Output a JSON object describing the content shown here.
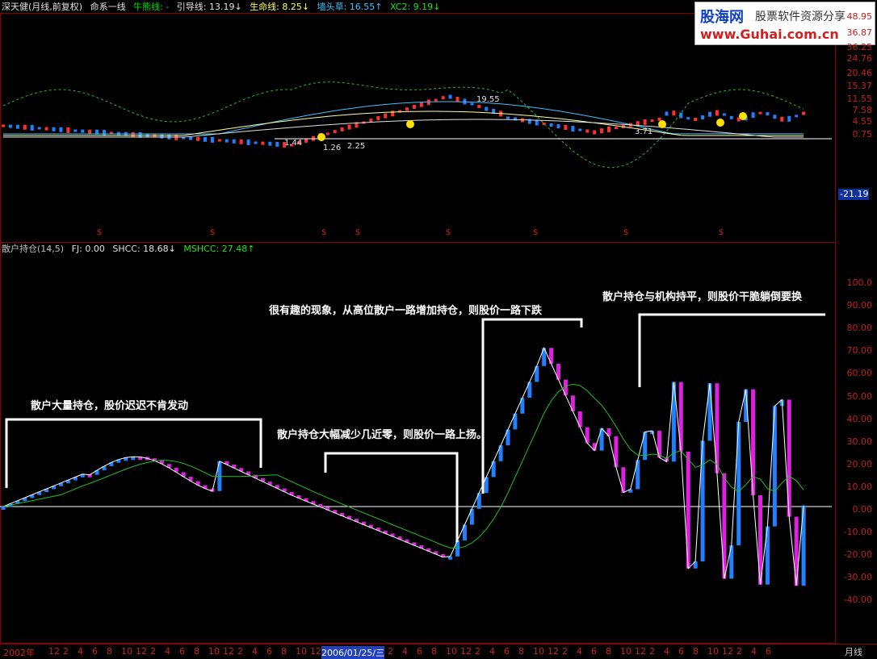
{
  "top": {
    "title": "深天健(月线,前复权)",
    "indicator_name": "命系一线",
    "items": [
      {
        "label": "牛熊线: -",
        "color": "#00e000"
      },
      {
        "label": "引导线: 13.19↓",
        "color": "#e0e0e0"
      },
      {
        "label": "生命线: 8.25↓",
        "color": "#ffff60"
      },
      {
        "label": "墙头草: 16.55↑",
        "color": "#40c0ff"
      },
      {
        "label": "XC2: 9.19↓",
        "color": "#20e020"
      }
    ],
    "axis_labels": [
      "48.95",
      "36.87",
      "36.25",
      "24.76",
      "20.46",
      "15.37",
      "11.55",
      "7.58",
      "4.55",
      "0.75"
    ],
    "price_marks": [
      "1.44",
      "1.26",
      "2.25",
      "19.55",
      "3.71"
    ],
    "side_value": "-21.19"
  },
  "bottom_panel": {
    "items": [
      {
        "label": "散户持仓(14,5)",
        "color": "#c0c0c0"
      },
      {
        "label": "FJ: 0.00",
        "color": "#e0e0e0"
      },
      {
        "label": "SHCC: 18.68↓",
        "color": "#e0e0e0"
      },
      {
        "label": "MSHCC: 27.48↑",
        "color": "#20e020"
      }
    ],
    "axis_labels": [
      "100.0",
      "90.00",
      "80.00",
      "70.00",
      "60.00",
      "50.00",
      "40.00",
      "30.00",
      "20.00",
      "10.00",
      "0.00",
      "-10.00",
      "-20.00",
      "-30.00",
      "-40.00"
    ]
  },
  "annotations": [
    "散户大量持仓，股价迟迟不肯发动",
    "散户持仓大幅减少几近零，则股价一路上扬。",
    "很有趣的现象，从高位散户一路增加持仓，则股价一路下跌",
    "散户持仓与机构持平，则股价干脆躺倒要换"
  ],
  "time_axis": {
    "labels": [
      "2002年",
      "12",
      "2",
      "4",
      "6",
      "8",
      "10",
      "12",
      "2",
      "4",
      "6",
      "8",
      "10",
      "12",
      "2",
      "4",
      "6",
      "8",
      "10",
      "12",
      "2006/01/25/三",
      "2",
      "4",
      "6",
      "8",
      "10",
      "12",
      "2",
      "4",
      "6",
      "8",
      "10",
      "12",
      "2",
      "4",
      "6",
      "8",
      "10",
      "12",
      "2",
      "4",
      "6",
      "8",
      "10",
      "12",
      "2",
      "4",
      "6"
    ],
    "period": "月线"
  },
  "logo": {
    "brand": "股海网",
    "slogan": "股票软件资源分享",
    "url": "www.Guhai.com.cn"
  }
}
